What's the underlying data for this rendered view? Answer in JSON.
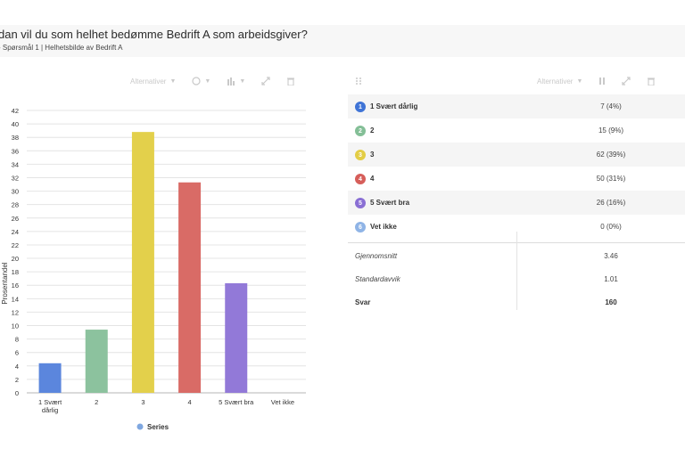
{
  "header": {
    "title": "dan vil du som helhet bedømme Bedrift A som arbeidsgiver?",
    "subtitle": "- Spørsmål 1 | Helhetsbilde av Bedrift A"
  },
  "chart_toolbar": {
    "alternatives_label": "Alternativer"
  },
  "table_toolbar": {
    "alternatives_label": "Alternativer"
  },
  "chart_data": {
    "type": "bar",
    "categories": [
      "1 Svært dårlig",
      "2",
      "3",
      "4",
      "5 Svært bra",
      "Vet ikke"
    ],
    "tick_labels": [
      [
        "1 Svært",
        "dårlig"
      ],
      [
        "2"
      ],
      [
        "3"
      ],
      [
        "4"
      ],
      [
        "5 Svært bra"
      ],
      [
        "Vet ikke"
      ]
    ],
    "series": [
      {
        "name": "Series",
        "values": [
          4.4,
          9.4,
          38.8,
          31.3,
          16.3,
          0
        ]
      }
    ],
    "bar_colors": [
      "#5b86dd",
      "#8cc29e",
      "#e3d04b",
      "#d96b66",
      "#9279d8",
      "#6a9fd8"
    ],
    "ylabel": "Prosentandel",
    "xlabel": "",
    "ylim": [
      0,
      42
    ],
    "ytick_step": 2,
    "grid": true,
    "legend": "bottom",
    "legend_color": "#7fa7e0"
  },
  "table": {
    "rows": [
      {
        "badge": "1",
        "label": "1 Svært dårlig",
        "value": "7 (4%)",
        "color": "#3f74d6"
      },
      {
        "badge": "2",
        "label": "2",
        "value": "15 (9%)",
        "color": "#84bf97"
      },
      {
        "badge": "3",
        "label": "3",
        "value": "62 (39%)",
        "color": "#e3cd45"
      },
      {
        "badge": "4",
        "label": "4",
        "value": "50 (31%)",
        "color": "#d65e5a"
      },
      {
        "badge": "5",
        "label": "5 Svært bra",
        "value": "26 (16%)",
        "color": "#8a6fd4"
      },
      {
        "badge": "6",
        "label": "Vet ikke",
        "value": "0 (0%)",
        "color": "#8fb4e6"
      }
    ],
    "stats": [
      {
        "label": "Gjennomsnitt",
        "value": "3.46"
      },
      {
        "label": "Standardavvik",
        "value": "1.01"
      },
      {
        "label": "Svar",
        "value": "160"
      }
    ]
  }
}
